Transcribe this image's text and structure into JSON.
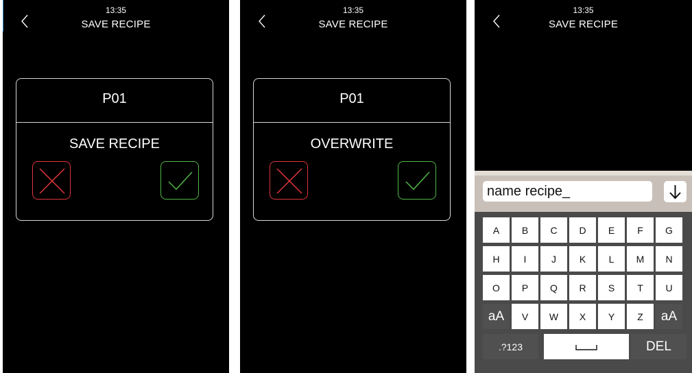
{
  "colors": {
    "screen_bg": "#000000",
    "cancel": "#e0353b",
    "confirm": "#4fb848",
    "dialog_border": "#d8d8d8",
    "keyboard_bg": "#4a4a4a",
    "keyboard_top": "#c8c0b8"
  },
  "screens": [
    {
      "status": {
        "time": "13:35"
      },
      "header": {
        "title": "SAVE RECIPE",
        "back_icon": "chevron-left-icon"
      },
      "dialog": {
        "code": "P01",
        "message": "SAVE RECIPE",
        "cancel_icon": "close-icon",
        "confirm_icon": "check-icon"
      }
    },
    {
      "status": {
        "time": "13:35"
      },
      "header": {
        "title": "SAVE RECIPE",
        "back_icon": "chevron-left-icon"
      },
      "dialog": {
        "code": "P01",
        "message": "OVERWRITE",
        "cancel_icon": "close-icon",
        "confirm_icon": "check-icon"
      }
    },
    {
      "status": {
        "time": "13:35"
      },
      "header": {
        "title": "SAVE RECIPE",
        "back_icon": "chevron-left-icon"
      },
      "keyboard": {
        "input_value": "name recipe_",
        "enter_icon": "arrow-down-icon",
        "rows": [
          [
            "A",
            "B",
            "C",
            "D",
            "E",
            "F",
            "G"
          ],
          [
            "H",
            "I",
            "J",
            "K",
            "L",
            "M",
            "N"
          ],
          [
            "O",
            "P",
            "Q",
            "R",
            "S",
            "T",
            "U"
          ],
          [
            "aA",
            "V",
            "W",
            "X",
            "Y",
            "Z",
            "aA"
          ]
        ],
        "symbols_label": ".?123",
        "space_label": "␣",
        "delete_label": "DEL"
      }
    }
  ]
}
